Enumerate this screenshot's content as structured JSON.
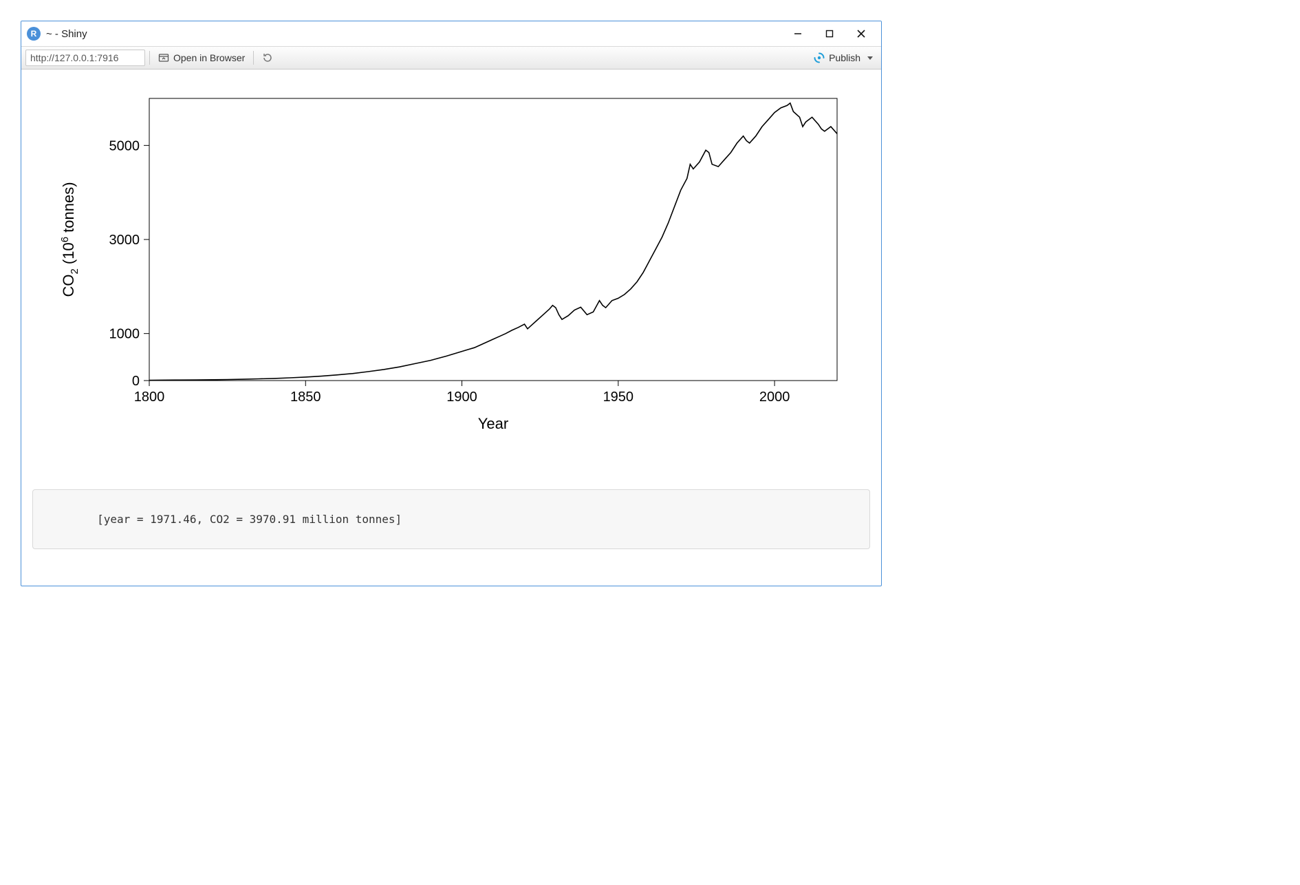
{
  "window": {
    "title": "~ - Shiny",
    "app_icon_letter": "R"
  },
  "toolbar": {
    "url": "http://127.0.0.1:7916",
    "open_in_browser_label": "Open in Browser",
    "publish_label": "Publish"
  },
  "output": {
    "text": "[year = 1971.46, CO2 = 3970.91 million tonnes]"
  },
  "chart_data": {
    "type": "line",
    "xlabel": "Year",
    "ylabel_html": "CO<sub>2</sub> (10<sup>6</sup> tonnes)",
    "ylabel_plain": "CO2 (10^6 tonnes)",
    "xlim": [
      1800,
      2020
    ],
    "ylim": [
      0,
      6000
    ],
    "x_ticks": [
      1800,
      1850,
      1900,
      1950,
      2000
    ],
    "y_ticks": [
      0,
      1000,
      3000,
      5000
    ],
    "series": [
      {
        "name": "CO2",
        "x": [
          1800,
          1805,
          1810,
          1815,
          1820,
          1825,
          1830,
          1835,
          1840,
          1845,
          1850,
          1855,
          1860,
          1865,
          1870,
          1875,
          1880,
          1885,
          1890,
          1895,
          1900,
          1902,
          1904,
          1906,
          1908,
          1910,
          1912,
          1914,
          1916,
          1918,
          1920,
          1921,
          1922,
          1924,
          1926,
          1928,
          1929,
          1930,
          1931,
          1932,
          1934,
          1936,
          1938,
          1940,
          1942,
          1944,
          1945,
          1946,
          1948,
          1950,
          1952,
          1954,
          1956,
          1958,
          1960,
          1962,
          1964,
          1966,
          1968,
          1970,
          1972,
          1973,
          1974,
          1976,
          1978,
          1979,
          1980,
          1982,
          1984,
          1986,
          1988,
          1990,
          1991,
          1992,
          1994,
          1996,
          1998,
          2000,
          2002,
          2004,
          2005,
          2006,
          2008,
          2009,
          2010,
          2012,
          2014,
          2015,
          2016,
          2018,
          2020
        ],
        "values": [
          8,
          10,
          12,
          14,
          18,
          22,
          28,
          36,
          46,
          58,
          74,
          94,
          120,
          150,
          190,
          235,
          290,
          360,
          430,
          520,
          620,
          660,
          700,
          760,
          820,
          880,
          940,
          1000,
          1070,
          1130,
          1200,
          1100,
          1160,
          1280,
          1400,
          1520,
          1600,
          1550,
          1400,
          1300,
          1380,
          1500,
          1560,
          1400,
          1460,
          1700,
          1600,
          1550,
          1700,
          1750,
          1830,
          1950,
          2100,
          2300,
          2550,
          2800,
          3050,
          3350,
          3700,
          4050,
          4300,
          4600,
          4500,
          4650,
          4900,
          4850,
          4600,
          4550,
          4700,
          4850,
          5050,
          5200,
          5100,
          5050,
          5200,
          5400,
          5550,
          5700,
          5800,
          5850,
          5900,
          5720,
          5600,
          5400,
          5500,
          5600,
          5450,
          5350,
          5300,
          5400,
          5250
        ]
      }
    ]
  }
}
